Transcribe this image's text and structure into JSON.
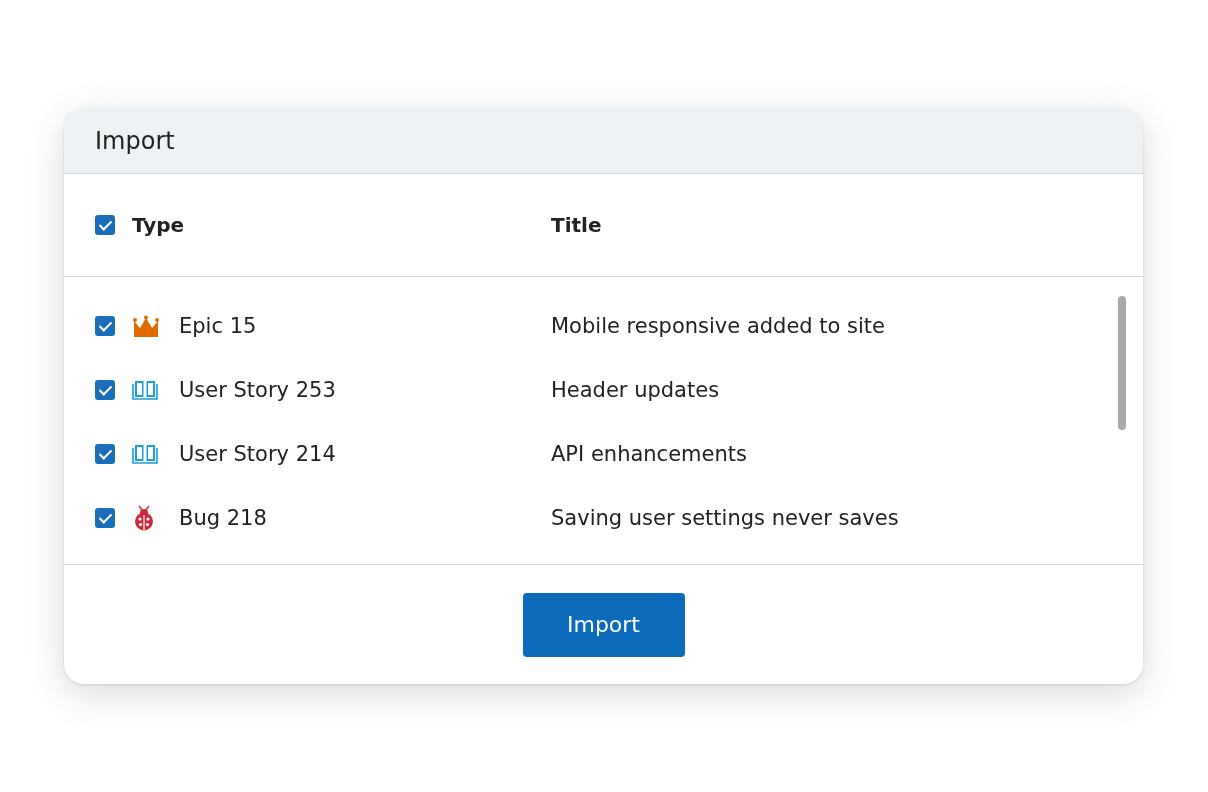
{
  "dialog": {
    "title": "Import"
  },
  "table": {
    "select_all": {
      "checked": true
    },
    "columns": [
      "Type",
      "Title"
    ],
    "rows": [
      {
        "kind": "epic",
        "type": "Epic 15",
        "title": "Mobile responsive added to site",
        "checked": true
      },
      {
        "kind": "story",
        "type": "User Story 253",
        "title": "Header updates",
        "checked": true
      },
      {
        "kind": "story",
        "type": "User Story 214",
        "title": "API enhancements",
        "checked": true
      },
      {
        "kind": "bug",
        "type": "Bug 218",
        "title": "Saving user settings never saves",
        "checked": true
      }
    ]
  },
  "button": "Import"
}
